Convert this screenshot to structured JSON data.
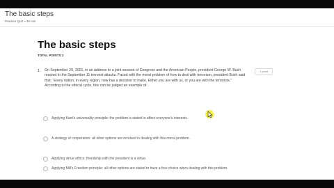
{
  "header": {
    "title": "The basic steps",
    "subtitle": "Practice Quiz • 30 min"
  },
  "main": {
    "title": "The basic steps",
    "total_points": "TOTAL POINTS 2"
  },
  "question": {
    "number": "1.",
    "text": "On September 20, 2001, in an address to a joint session of Congress and the American People, president George W. Bush reacted to the September 11 terrorist attacks. Faced with the moral problem of how to deal with terrorism, president Bush said that: “Every nation, in every region, now has a decision to make. Either you are with us, or you are with the terrorists.” According to the ethical cycle, this can be judged an example of:",
    "points": "1 point",
    "options": [
      {
        "label": "Applying Kant's universality principle: the problem is stated to affect everyone's interests."
      },
      {
        "label": "A strategy of cooperation: all other options are involved in dealing with this moral problem."
      },
      {
        "label": "Applying virtue ethics: friendship with the president is a virtue."
      },
      {
        "label": "Applying Mill's Freedom principle: all other options are stated to have a free choice when dealing with this problem."
      }
    ]
  },
  "colors": {
    "cursor": "#f5ee2a"
  }
}
